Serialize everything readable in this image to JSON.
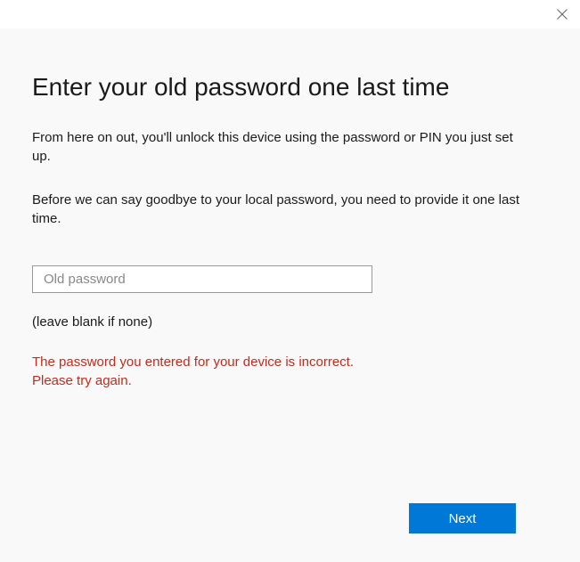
{
  "titlebar": {
    "close_icon": "close"
  },
  "header": {
    "title": "Enter your old password one last time"
  },
  "body": {
    "paragraph1": "From here on out, you'll unlock this device using the password or PIN you just set up.",
    "paragraph2": "Before we can say goodbye to your local password, you need to provide it one last time.",
    "password_placeholder": "Old password",
    "password_value": "",
    "hint": "(leave blank if none)",
    "error_line1": "The password you entered for your device is incorrect.",
    "error_line2": "Please try again."
  },
  "footer": {
    "next_label": "Next"
  },
  "colors": {
    "accent": "#0078d7",
    "error": "#c42b1c",
    "content_bg": "#f9f9f9"
  }
}
